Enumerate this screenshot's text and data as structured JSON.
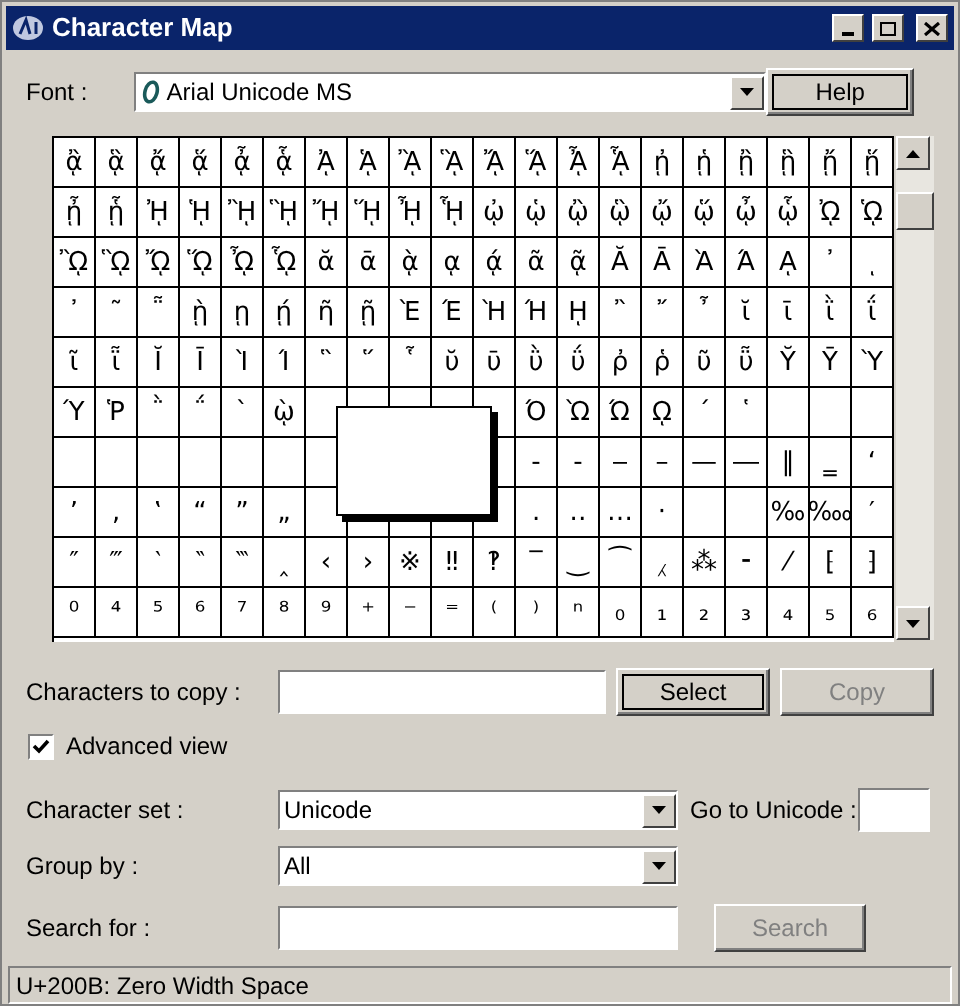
{
  "window": {
    "title": "Character Map"
  },
  "font": {
    "label": "Font :",
    "value": "Arial Unicode MS"
  },
  "help_button": "Help",
  "grid": {
    "rows": [
      [
        "ᾂ",
        "ᾃ",
        "ᾄ",
        "ᾅ",
        "ᾆ",
        "ᾇ",
        "ᾈ",
        "ᾉ",
        "ᾊ",
        "ᾋ",
        "ᾌ",
        "ᾍ",
        "ᾎ",
        "ᾏ",
        "ᾐ",
        "ᾑ",
        "ᾒ",
        "ᾓ",
        "ᾔ",
        "ᾕ"
      ],
      [
        "ᾖ",
        "ᾗ",
        "ᾘ",
        "ᾙ",
        "ᾚ",
        "ᾛ",
        "ᾜ",
        "ᾝ",
        "ᾞ",
        "ᾟ",
        "ᾠ",
        "ᾡ",
        "ᾢ",
        "ᾣ",
        "ᾤ",
        "ᾥ",
        "ᾦ",
        "ᾧ",
        "ᾨ",
        "ᾩ"
      ],
      [
        "ᾪ",
        "ᾫ",
        "ᾬ",
        "ᾭ",
        "ᾮ",
        "ᾯ",
        "ᾰ",
        "ᾱ",
        "ᾲ",
        "ᾳ",
        "ᾴ",
        "ᾶ",
        "ᾷ",
        "Ᾰ",
        "Ᾱ",
        "Ὰ",
        "Ά",
        "ᾼ",
        "᾽",
        "ι"
      ],
      [
        "᾿",
        "῀",
        "῁",
        "ῂ",
        "ῃ",
        "ῄ",
        "ῆ",
        "ῇ",
        "Ὲ",
        "Έ",
        "Ὴ",
        "Ή",
        "ῌ",
        "῍",
        "῎",
        "῏",
        "ῐ",
        "ῑ",
        "ῒ",
        "ΐ"
      ],
      [
        "ῖ",
        "ῗ",
        "Ῐ",
        "Ῑ",
        "Ὶ",
        "Ί",
        "῝",
        "῞",
        "῟",
        "ῠ",
        "ῡ",
        "ῢ",
        "ΰ",
        "ῤ",
        "ῥ",
        "ῦ",
        "ῧ",
        "Ῠ",
        "Ῡ",
        "Ὺ"
      ],
      [
        "Ύ",
        "Ῥ",
        "῭",
        "΅",
        "`",
        "ῲ",
        null,
        null,
        null,
        null,
        null,
        "Ό",
        "Ὼ",
        "Ώ",
        "ῼ",
        "´",
        "῾",
        null,
        null,
        null
      ],
      [
        null,
        null,
        null,
        null,
        null,
        null,
        null,
        null,
        null,
        null,
        null,
        "‐",
        "‑",
        "‒",
        "–",
        "—",
        "―",
        "‖",
        "‗",
        "‘"
      ],
      [
        "’",
        "‚",
        "‛",
        "“",
        "”",
        "„",
        null,
        null,
        null,
        null,
        null,
        "․",
        "‥",
        "…",
        "‧",
        null,
        null,
        "‰",
        "‱",
        "′"
      ],
      [
        "″",
        "‴",
        "‵",
        "‶",
        "‷",
        "‸",
        "‹",
        "›",
        "※",
        "‼",
        "‽",
        "‾",
        "‿",
        "⁀",
        "⁁",
        "⁂",
        "⁃",
        "⁄",
        "⁅",
        "⁆"
      ],
      [
        "⁰",
        "⁴",
        "⁵",
        "⁶",
        "⁷",
        "⁸",
        "⁹",
        "⁺",
        "⁻",
        "⁼",
        "⁽",
        "⁾",
        "ⁿ",
        "₀",
        "₁",
        "₂",
        "₃",
        "₄",
        "₅",
        "₆"
      ]
    ]
  },
  "copy": {
    "label": "Characters to copy :",
    "select_button": {
      "label": "Select",
      "disabled": false
    },
    "copy_button": {
      "label": "Copy",
      "disabled": true
    }
  },
  "advanced_view": {
    "label": "Advanced view",
    "checked": true
  },
  "character_set": {
    "label": "Character set :",
    "value": "Unicode"
  },
  "go_to_unicode": {
    "label": "Go to Unicode :"
  },
  "group_by": {
    "label": "Group by :",
    "value": "All"
  },
  "search": {
    "label": "Search for :",
    "button": {
      "label": "Search",
      "disabled": true
    }
  },
  "status_bar": "U+200B: Zero Width Space"
}
